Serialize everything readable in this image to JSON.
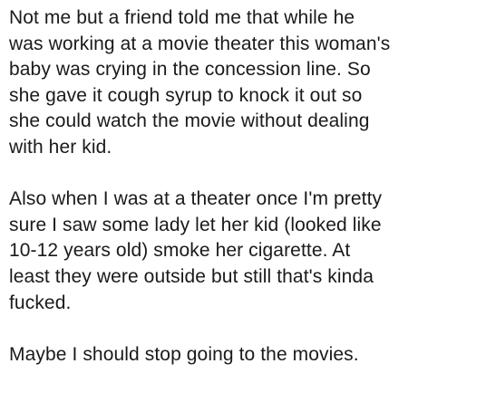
{
  "post": {
    "paragraphs": [
      "Not me but a friend told me that while he\nwas working at a movie theater this woman's\nbaby was crying in the concession line. So\nshe gave it cough syrup to knock it out so\nshe could watch the movie without dealing\nwith her kid.",
      "Also when I was at a theater once I'm pretty\nsure I saw some lady let her kid (looked like\n10-12 years old) smoke her cigarette. At\nleast they were outside but still that's kinda\nfucked.",
      "Maybe I should stop going to the movies."
    ]
  }
}
